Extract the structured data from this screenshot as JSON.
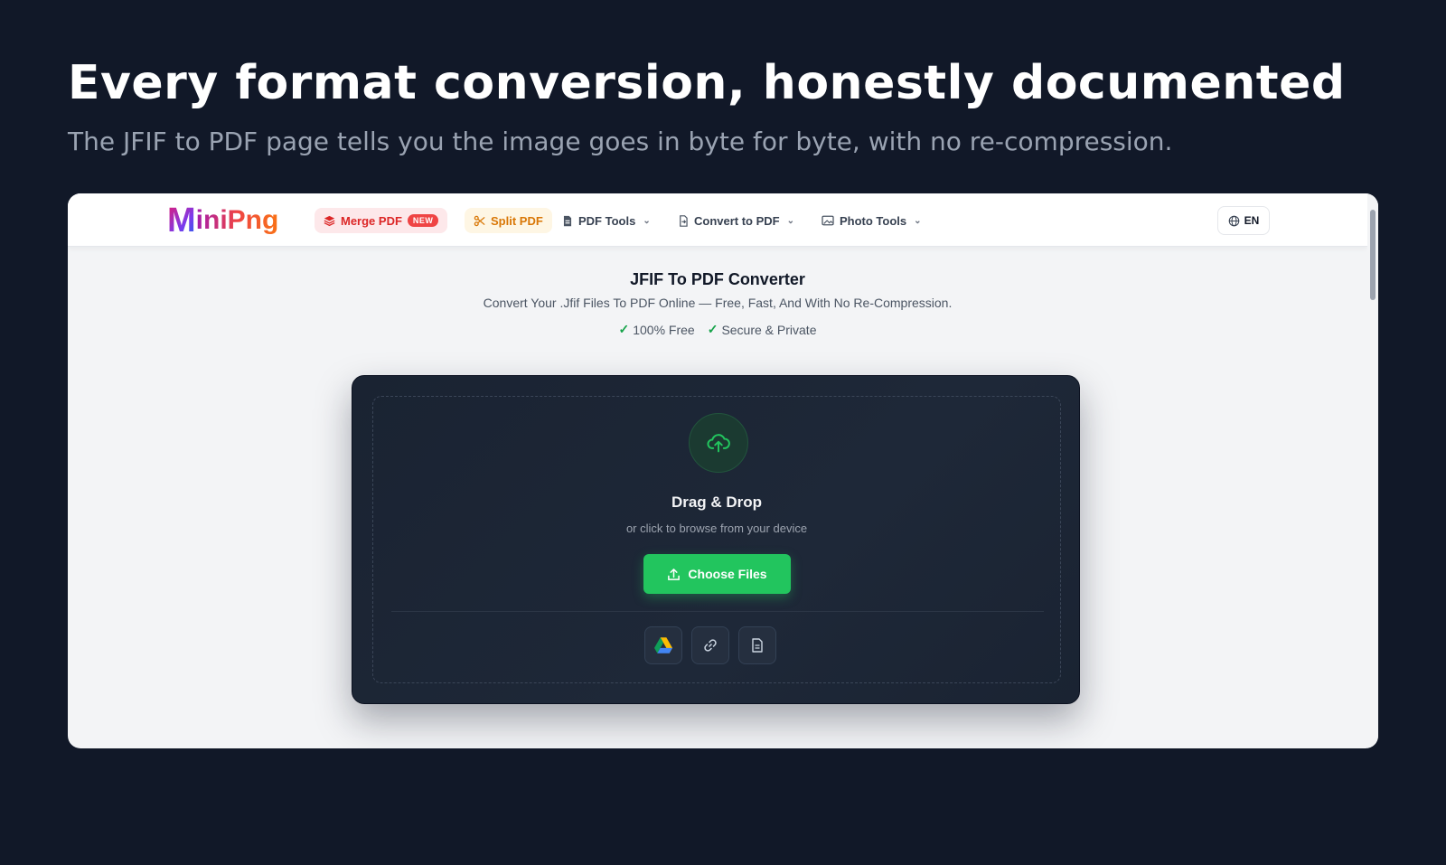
{
  "hero": {
    "title": "Every format conversion, honestly documented",
    "subtitle": "The JFIF to PDF page tells you the image goes in byte for byte, with no re-compression."
  },
  "navbar": {
    "logo": {
      "first_letter": "M",
      "rest": "iniPng"
    },
    "items": [
      {
        "label": "Merge PDF",
        "badge": "NEW",
        "icon": "layers-icon",
        "color": "#dc2626"
      },
      {
        "label": "Split PDF",
        "icon": "scissors-icon",
        "color": "#d97706"
      },
      {
        "label": "PDF Tools",
        "icon": "pdf-file-icon",
        "dropdown": true
      },
      {
        "label": "Convert to PDF",
        "icon": "convert-icon",
        "dropdown": true
      },
      {
        "label": "Photo Tools",
        "icon": "image-icon",
        "dropdown": true
      }
    ],
    "language": "EN"
  },
  "page": {
    "title": "JFIF To PDF Converter",
    "description": "Convert Your .Jfif Files To PDF Online — Free, Fast, And With No Re-Compression.",
    "features": [
      "100% Free",
      "Secure & Private"
    ]
  },
  "uploader": {
    "title": "Drag & Drop",
    "subtitle": "or click to browse from your device",
    "button_label": "Choose Files",
    "sources": [
      "google-drive-icon",
      "link-icon",
      "document-icon"
    ]
  },
  "colors": {
    "background": "#111828",
    "accent_green": "#22c55e",
    "card_dark": "#1a2332"
  }
}
